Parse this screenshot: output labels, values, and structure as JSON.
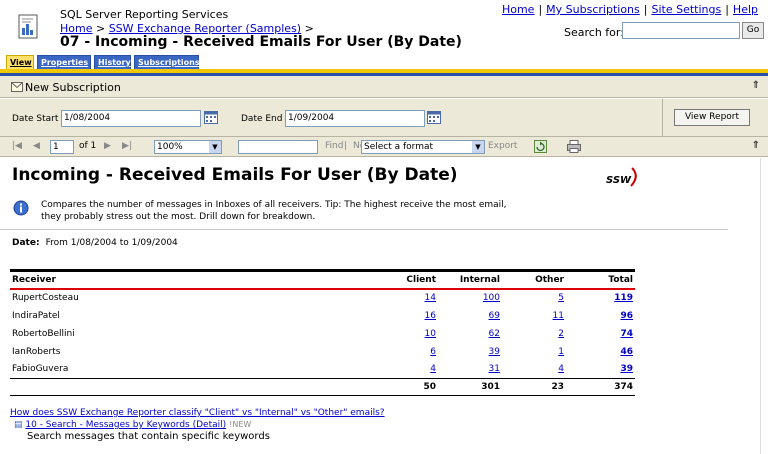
{
  "header": {
    "service_title": "SQL Server Reporting Services",
    "breadcrumb_home": "Home",
    "breadcrumb_sep1": ">",
    "breadcrumb_folder": "SSW Exchange Reporter (Samples)",
    "breadcrumb_sep2": ">",
    "page_title": "07 - Incoming - Received Emails For User (By Date)",
    "links": [
      "Home",
      "My Subscriptions",
      "Site Settings",
      "Help"
    ],
    "link_separator": "|",
    "search_label": "Search for:",
    "search_value": "",
    "go_label": "Go"
  },
  "tabs": [
    {
      "label": "View",
      "active": true
    },
    {
      "label": "Properties",
      "active": false
    },
    {
      "label": "History",
      "active": false
    },
    {
      "label": "Subscriptions",
      "active": false
    }
  ],
  "subscription_bar": {
    "label": "New Subscription",
    "collapse": "⇑"
  },
  "params": {
    "date_start_label": "Date Start",
    "date_start_value": "1/08/2004",
    "date_end_label": "Date End",
    "date_end_value": "1/09/2004",
    "view_report_label": "View Report"
  },
  "toolbar": {
    "page_current": "1",
    "page_of": "of 1",
    "zoom": "100%",
    "find_value": "",
    "find_label": "Find",
    "find_sep": "|",
    "next_label": "Next",
    "format_select": "Select a format",
    "export_label": "Export",
    "collapse": "⇑"
  },
  "report": {
    "title": "Incoming - Received Emails For User (By Date)",
    "logo_text": "SSW",
    "description": "Compares the number of messages in Inboxes of all receivers. Tip: The highest receive the most email, they probably stress out the most. Drill down for breakdown.",
    "date_label": "Date:",
    "date_value": "From 1/08/2004 to 1/09/2004",
    "columns": [
      "Receiver",
      "Client",
      "Internal",
      "Other",
      "Total"
    ],
    "rows": [
      {
        "receiver": "RupertCosteau",
        "client": "14",
        "internal": "100",
        "other": "5",
        "total": "119"
      },
      {
        "receiver": "IndiraPatel",
        "client": "16",
        "internal": "69",
        "other": "11",
        "total": "96"
      },
      {
        "receiver": "RobertoBellini",
        "client": "10",
        "internal": "62",
        "other": "2",
        "total": "74"
      },
      {
        "receiver": "IanRoberts",
        "client": "6",
        "internal": "39",
        "other": "1",
        "total": "46"
      },
      {
        "receiver": "FabioGuvera",
        "client": "4",
        "internal": "31",
        "other": "4",
        "total": "39"
      }
    ],
    "totals": {
      "client": "50",
      "internal": "301",
      "other": "23",
      "total": "374"
    },
    "faq_link": "How does SSW Exchange Reporter classify \"Client\" vs \"Internal\" vs \"Other\" emails?",
    "next_item_title": "10 - Search - Messages by Keywords (Detail)",
    "next_item_badge": "!NEW",
    "next_item_desc": "Search messages that contain specific keywords"
  }
}
